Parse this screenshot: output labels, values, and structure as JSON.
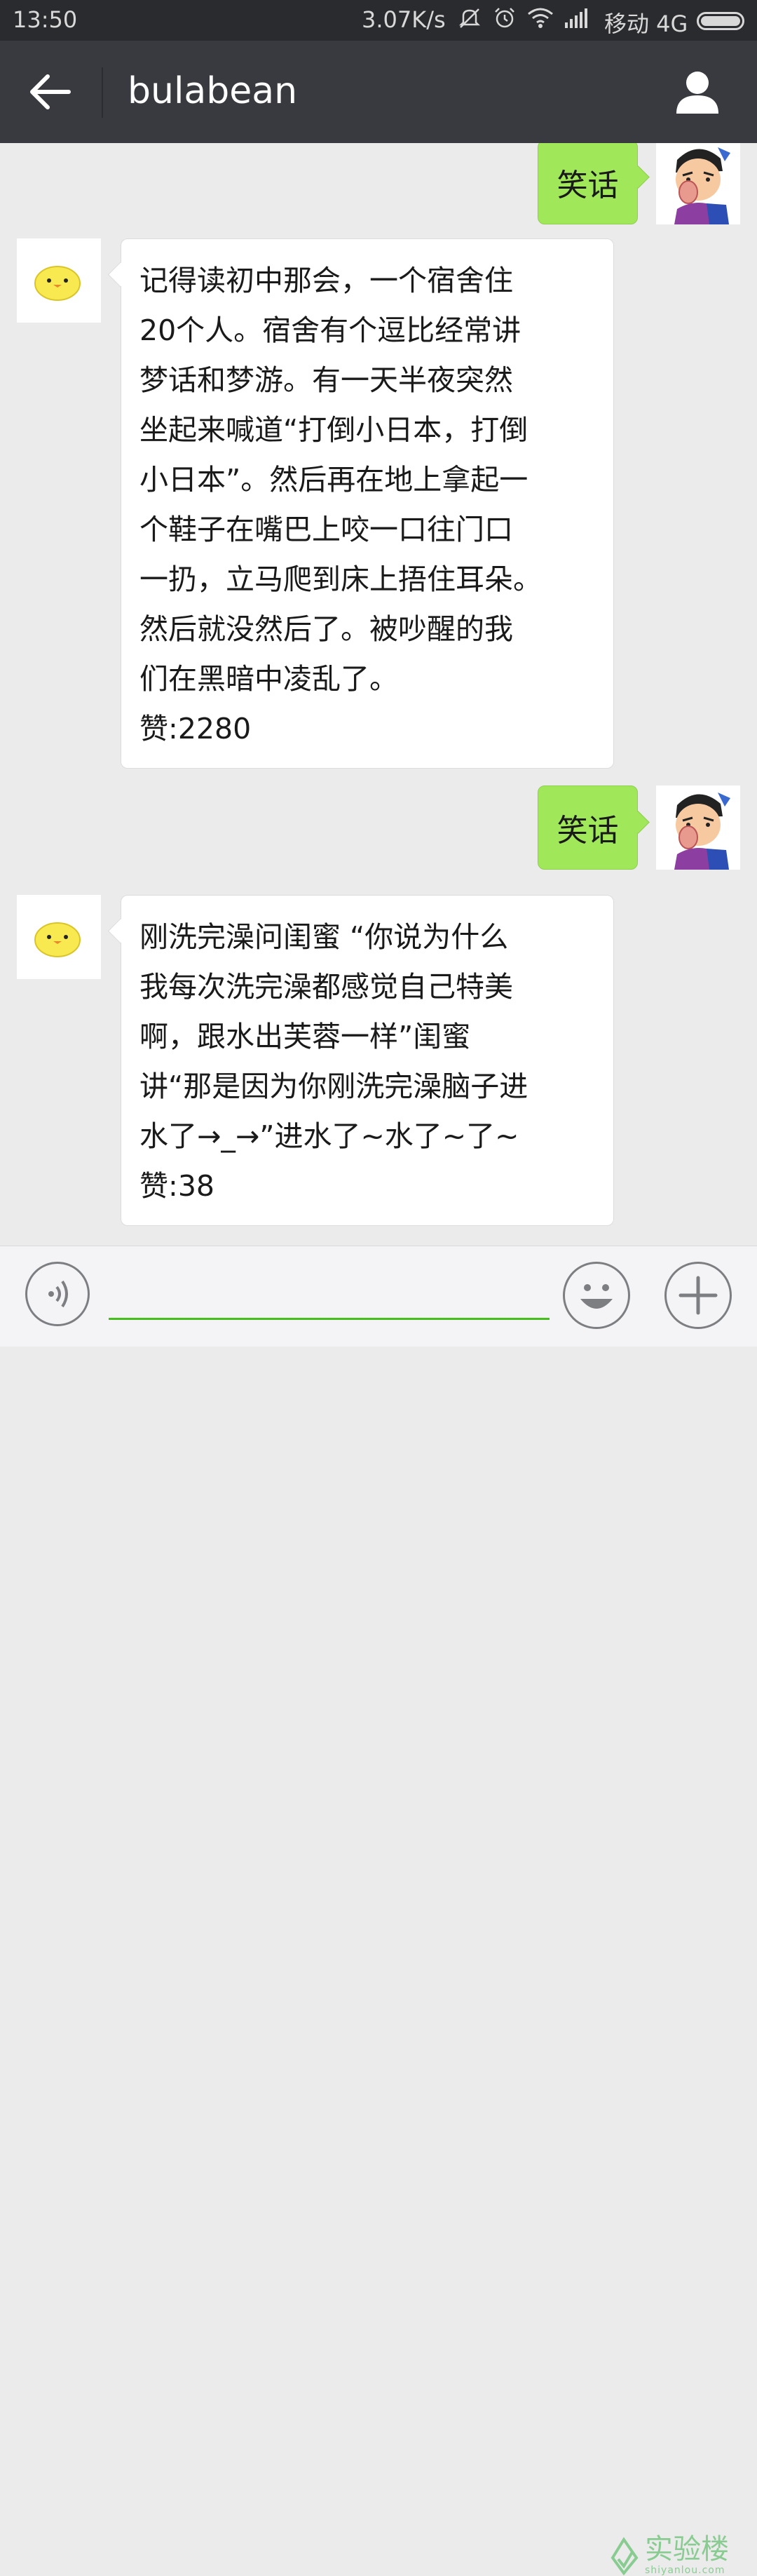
{
  "status_bar": {
    "time": "13:50",
    "network_speed": "3.07K/s",
    "carrier": "移动 4G",
    "icons": [
      "mute-icon",
      "alarm-icon",
      "wifi-icon",
      "signal-icon",
      "battery-icon"
    ]
  },
  "title_bar": {
    "title": "bulabean",
    "back_icon": "arrow-left-icon",
    "profile_icon": "person-icon"
  },
  "messages": [
    {
      "side": "right",
      "text": "笑话"
    },
    {
      "side": "left",
      "lines": [
        "记得读初中那会，一个宿舍住",
        "20个人。宿舍有个逗比经常讲",
        "梦话和梦游。有一天半夜突然",
        "坐起来喊道“打倒小日本，打倒",
        "小日本”。然后再在地上拿起一",
        "个鞋子在嘴巴上咬一口往门口",
        "一扔，立马爬到床上捂住耳朵。",
        "然后就没然后了。被吵醒的我",
        "们在黑暗中凌乱了。",
        "赞:2280"
      ]
    },
    {
      "side": "right",
      "text": "笑话"
    },
    {
      "side": "left",
      "lines": [
        "刚洗完澡问闺蜜 “你说为什么",
        "我每次洗完澡都感觉自己特美",
        "啊，跟水出芙蓉一样”闺蜜",
        "讲“那是因为你刚洗完澡脑子进",
        "水了→_→”进水了~水了~了~",
        "赞:38"
      ]
    }
  ],
  "input_bar": {
    "voice_icon": "voice-icon",
    "input_value": "",
    "emoji_icon": "smiley-icon",
    "plus_icon": "plus-icon"
  },
  "watermark": {
    "main": "实验楼",
    "sub": "shiyanlou.com"
  },
  "colors": {
    "status_bar_bg": "#2a2b2e",
    "title_bar_bg": "#393a3f",
    "chat_bg": "#ebebeb",
    "sent_bubble": "#a0e75a",
    "received_bubble": "#ffffff",
    "input_underline": "#45c01a"
  }
}
